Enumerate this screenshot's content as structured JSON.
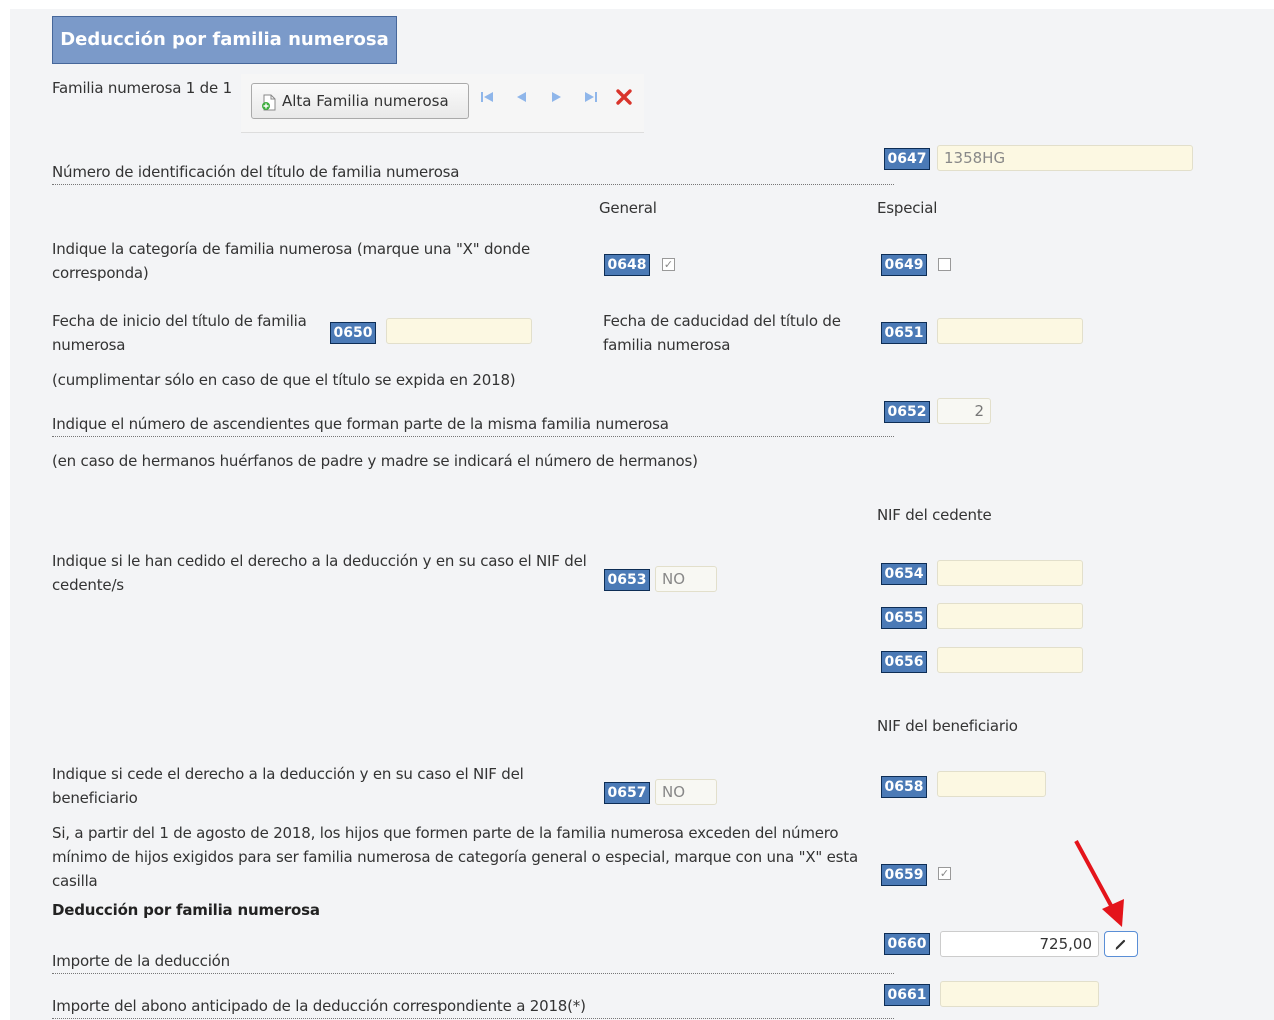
{
  "section_title": "Deducción por familia numerosa",
  "toolbar": {
    "record_label": "Familia numerosa 1 de 1",
    "add_button": "Alta Familia numerosa",
    "first_icon": "first-record-icon",
    "prev_icon": "prev-record-icon",
    "next_icon": "next-record-icon",
    "last_icon": "last-record-icon",
    "delete_icon": "delete-record-icon"
  },
  "colors": {
    "box": "#4b7ab6",
    "title": "#7b9ac9",
    "input": "#fcf8e2",
    "delete": "#d9342b",
    "arrow": "#e4141b"
  },
  "headers": {
    "general": "General",
    "especial": "Especial",
    "nif_cedente": "NIF del cedente",
    "nif_beneficiario": "NIF del beneficiario"
  },
  "rows": {
    "r0647": {
      "label": "Número de identificación del título de familia numerosa",
      "box": "0647",
      "value": "1358HG"
    },
    "category": {
      "label": "Indique la categoría de familia numerosa (marque una \"X\" donde corresponda)"
    },
    "r0648": {
      "box": "0648",
      "checked": true
    },
    "r0649": {
      "box": "0649",
      "checked": false
    },
    "r0650": {
      "label": "Fecha de inicio del título de familia numerosa",
      "box": "0650",
      "value": ""
    },
    "r0651": {
      "label": "Fecha de caducidad del título de familia numerosa",
      "box": "0651",
      "value": ""
    },
    "note_2018": "(cumplimentar sólo en caso de que el título se expida en 2018)",
    "r0652": {
      "label": "Indique el número de ascendientes que forman parte de la misma familia numerosa",
      "box": "0652",
      "value": "2"
    },
    "note_huerfanos": "(en caso de hermanos huérfanos de padre y madre se indicará el número de hermanos)",
    "r0653": {
      "label": "Indique si le han cedido el derecho a la deducción y en su caso el NIF del cedente/s",
      "box": "0653",
      "value": "NO"
    },
    "r0654": {
      "box": "0654",
      "value": ""
    },
    "r0655": {
      "box": "0655",
      "value": ""
    },
    "r0656": {
      "box": "0656",
      "value": ""
    },
    "r0657": {
      "label": "Indique si cede el derecho a la deducción y en su caso el NIF del beneficiario",
      "box": "0657",
      "value": "NO"
    },
    "r0658": {
      "box": "0658",
      "value": ""
    },
    "r0659": {
      "label": "Si, a partir del 1 de agosto de 2018, los hijos que formen parte de la familia numerosa exceden del número mínimo de hijos exigidos para ser familia numerosa de categoría general o especial, marque con una \"X\" esta casilla",
      "box": "0659",
      "checked": true
    },
    "subtitle": "Deducción por familia numerosa",
    "r0660": {
      "label": "Importe de la deducción",
      "box": "0660",
      "value": "725,00",
      "edit_icon": "pencil-icon"
    },
    "r0661": {
      "label": "Importe del abono anticipado de la deducción correspondiente a 2018(*)",
      "box": "0661",
      "value": ""
    }
  }
}
